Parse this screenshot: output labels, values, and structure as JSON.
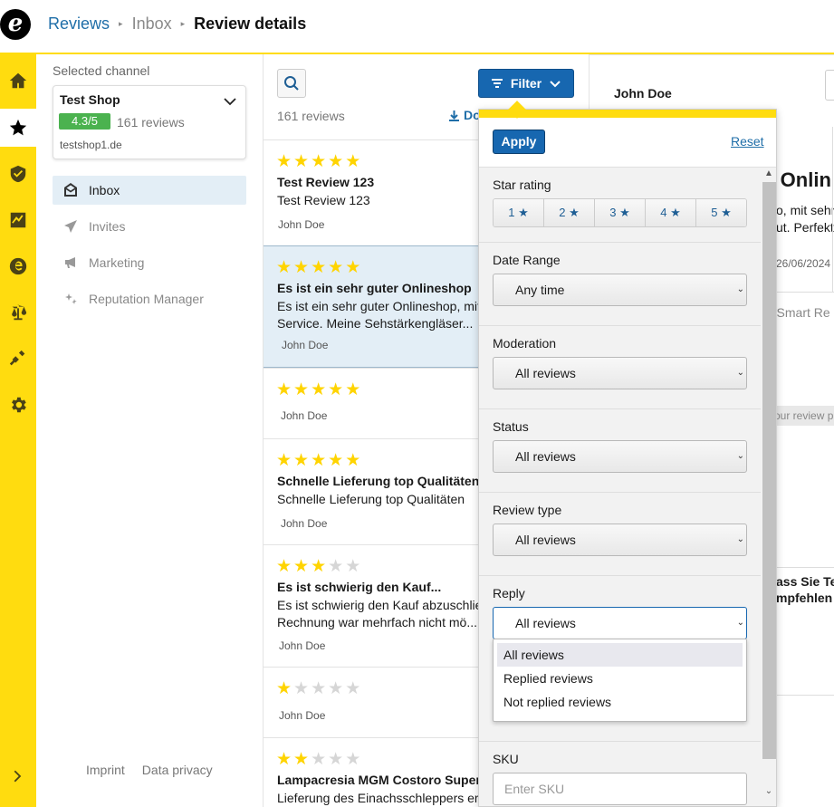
{
  "header": {
    "logo": "e",
    "breadcrumb": [
      "Reviews",
      "Inbox",
      "Review details"
    ]
  },
  "rail": {
    "items": [
      "home-icon",
      "star-icon",
      "shield-icon",
      "chart-icon",
      "e-logo-icon",
      "scales-icon",
      "plug-icon",
      "gear-icon",
      "chevron-right-icon"
    ]
  },
  "sidebar": {
    "selected_label": "Selected channel",
    "channel": {
      "name": "Test Shop",
      "rating": "4.3/5",
      "count": "161 reviews",
      "domain": "testshop1.de"
    },
    "nav": [
      {
        "label": "Inbox",
        "icon": "inbox-icon",
        "active": true
      },
      {
        "label": "Invites",
        "icon": "paper-plane-icon"
      },
      {
        "label": "Marketing",
        "icon": "megaphone-icon"
      },
      {
        "label": "Reputation Manager",
        "icon": "sparkles-icon"
      }
    ],
    "footer": [
      "Imprint",
      "Data privacy"
    ]
  },
  "list": {
    "filter_label": "Filter",
    "count": "161 reviews",
    "download": "Do",
    "reviews": [
      {
        "stars": 5,
        "title": "Test Review 123",
        "body": [
          "Test Review 123"
        ],
        "author": "John Doe"
      },
      {
        "stars": 5,
        "title": "Es ist ein sehr guter Onlineshop",
        "body": [
          "Es ist ein sehr guter Onlineshop, mit",
          "Service. Meine Sehstärkengläser..."
        ],
        "author": "John Doe"
      },
      {
        "stars": 5,
        "title": "",
        "body": [],
        "author": "John Doe"
      },
      {
        "stars": 5,
        "title": "Schnelle Lieferung top Qualitäten",
        "body": [
          "Schnelle Lieferung top Qualitäten"
        ],
        "author": "John Doe"
      },
      {
        "stars": 3,
        "title": "Es ist schwierig den Kauf...",
        "body": [
          "Es ist schwierig den Kauf abzuschlie",
          "Rechnung war mehrfach nicht mö..."
        ],
        "author": "John Doe"
      },
      {
        "stars": 1,
        "title": "",
        "body": [],
        "author": "John Doe"
      },
      {
        "stars": 2,
        "title": "Lampacresia MGM Costoro Super-M",
        "body": [
          "Lieferung des Einachsschleppers er"
        ],
        "author": ""
      }
    ]
  },
  "detail": {
    "author": "John Doe",
    "title_fragment": "r Onlin",
    "body_fragment": [
      "o, mit sehr",
      "ut. Perfekt"
    ],
    "date": "26/06/2024",
    "smart": "r Smart Re",
    "your_review": "our review p",
    "frag2": [
      "ass Sie Te",
      "mpfehlen w"
    ]
  },
  "filter": {
    "apply": "Apply",
    "reset": "Reset",
    "star_rating_label": "Star rating",
    "star_buttons": [
      "1 ★",
      "2 ★",
      "3 ★",
      "4 ★",
      "5 ★"
    ],
    "date_range_label": "Date Range",
    "date_range_value": "Any time",
    "moderation_label": "Moderation",
    "moderation_value": "All reviews",
    "status_label": "Status",
    "status_value": "All reviews",
    "review_type_label": "Review type",
    "review_type_value": "All reviews",
    "reply_label": "Reply",
    "reply_value": "All reviews",
    "reply_options": [
      "All reviews",
      "Replied reviews",
      "Not replied reviews"
    ],
    "sku_label": "SKU",
    "sku_placeholder": "Enter SKU"
  },
  "colors": {
    "accent": "#ffdc0f",
    "primary": "#1767b0",
    "rating_green": "#4bb24f",
    "star": "#ffd400"
  }
}
